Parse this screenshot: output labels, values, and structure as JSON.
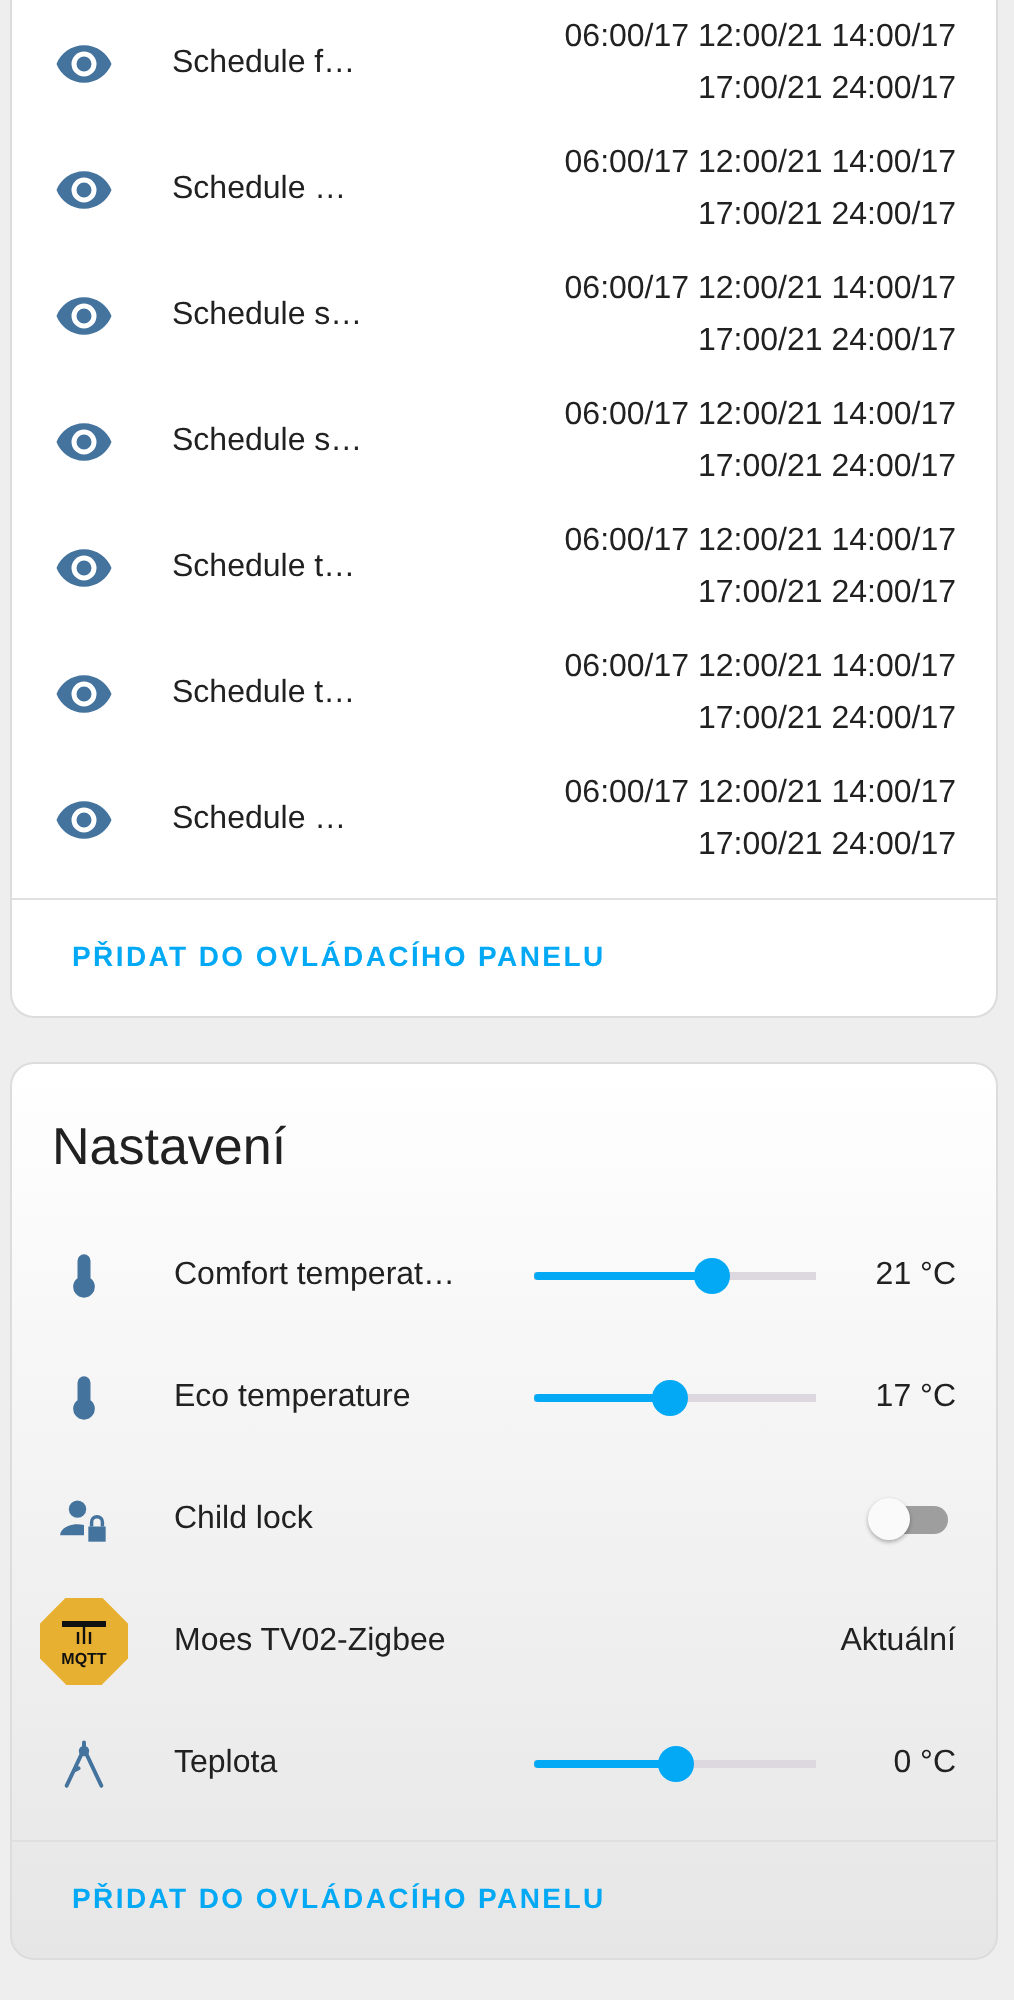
{
  "schedules": {
    "rows": [
      {
        "name": "Schedule f…",
        "line1": "06:00/17 12:00/21 14:00/17",
        "line2": "17:00/21 24:00/17"
      },
      {
        "name": "Schedule …",
        "line1": "06:00/17 12:00/21 14:00/17",
        "line2": "17:00/21 24:00/17"
      },
      {
        "name": "Schedule s…",
        "line1": "06:00/17 12:00/21 14:00/17",
        "line2": "17:00/21 24:00/17"
      },
      {
        "name": "Schedule s…",
        "line1": "06:00/17 12:00/21 14:00/17",
        "line2": "17:00/21 24:00/17"
      },
      {
        "name": "Schedule t…",
        "line1": "06:00/17 12:00/21 14:00/17",
        "line2": "17:00/21 24:00/17"
      },
      {
        "name": "Schedule t…",
        "line1": "06:00/17 12:00/21 14:00/17",
        "line2": "17:00/21 24:00/17"
      },
      {
        "name": "Schedule …",
        "line1": "06:00/17 12:00/21 14:00/17",
        "line2": "17:00/21 24:00/17"
      }
    ],
    "action": "PŘIDAT DO OVLÁDACÍHO PANELU"
  },
  "settings": {
    "title": "Nastavení",
    "rows": [
      {
        "kind": "slider",
        "name": "Comfort temperat…",
        "level": 0.63,
        "reading": "21 °C"
      },
      {
        "kind": "slider",
        "name": "Eco temperature",
        "level": 0.48,
        "reading": "17 °C"
      },
      {
        "kind": "toggle",
        "name": "Child lock",
        "on": false
      },
      {
        "kind": "text",
        "name": "Moes TV02-Zigbee",
        "logo_text": "MQTT",
        "value": "Aktuální"
      },
      {
        "kind": "slider",
        "name": "Teplota",
        "level": 0.5,
        "reading": "0 °C"
      }
    ],
    "action": "PŘIDAT DO OVLÁDACÍHO PANELU"
  }
}
